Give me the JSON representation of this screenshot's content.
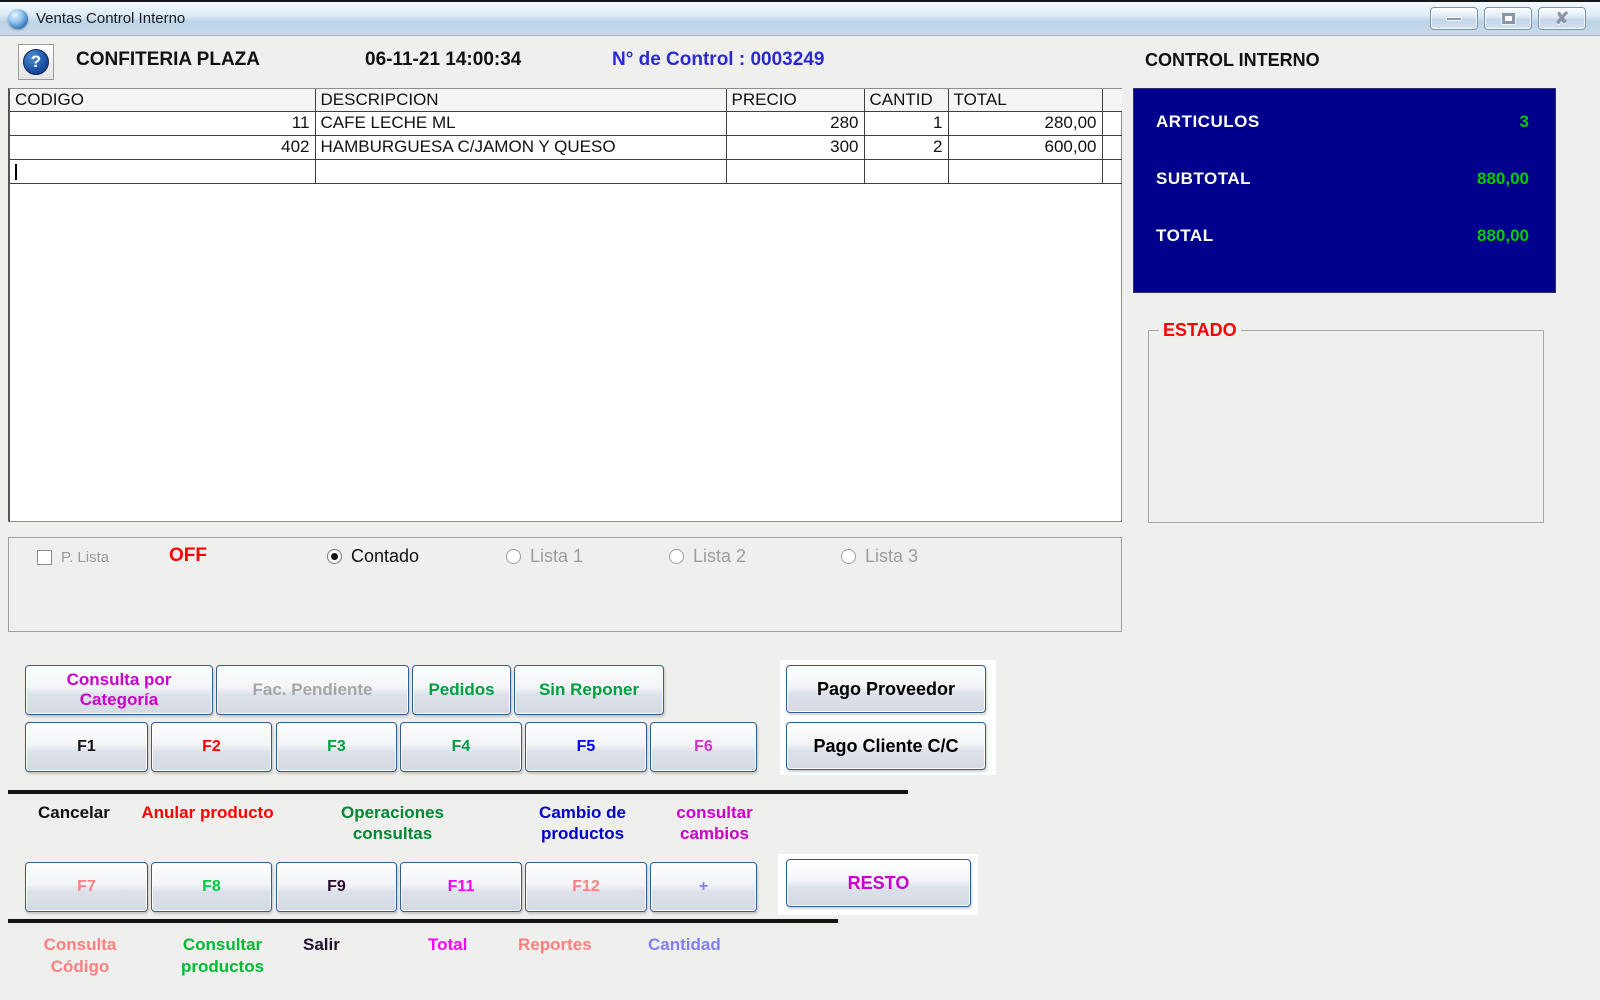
{
  "window": {
    "title": "Ventas Control Interno"
  },
  "header": {
    "store": "CONFITERIA PLAZA",
    "datetime": "06-11-21  14:00:34",
    "control_label": "N° de Control :  ",
    "control_number": "0003249",
    "right_title": "CONTROL INTERNO"
  },
  "table": {
    "columns": [
      "CODIGO",
      "DESCRIPCION",
      "PRECIO",
      "CANTID",
      "TOTAL"
    ],
    "rows": [
      {
        "codigo": "11",
        "descripcion": "CAFE LECHE ML",
        "precio": "280",
        "cantid": "1",
        "total": "280,00"
      },
      {
        "codigo": "402",
        "descripcion": "HAMBURGUESA C/JAMON Y QUESO",
        "precio": "300",
        "cantid": "2",
        "total": "600,00"
      }
    ]
  },
  "summary": {
    "articulos_label": "ARTICULOS",
    "articulos_value": "3",
    "subtotal_label": "SUBTOTAL",
    "subtotal_value": "880,00",
    "total_label": "TOTAL",
    "total_value": "880,00"
  },
  "estado_label": "ESTADO",
  "options": {
    "plista_label": "P. Lista",
    "off_label": "OFF",
    "radios": [
      {
        "label": "Contado",
        "selected": true,
        "enabled": true
      },
      {
        "label": "Lista 1",
        "selected": false,
        "enabled": false
      },
      {
        "label": "Lista 2",
        "selected": false,
        "enabled": false
      },
      {
        "label": "Lista 3",
        "selected": false,
        "enabled": false
      }
    ]
  },
  "actions_row1": [
    {
      "label": "Consulta por Categoría",
      "color": "#cc00cc"
    },
    {
      "label": "Fac. Pendiente",
      "color": "#a6a6a6"
    },
    {
      "label": "Pedidos",
      "color": "#00a040"
    },
    {
      "label": "Sin Reponer",
      "color": "#00a040"
    }
  ],
  "pago_proveedor_label": "Pago Proveedor",
  "fkeys_row1": [
    {
      "label": "F1",
      "color": "#111111"
    },
    {
      "label": "F2",
      "color": "#ff0000"
    },
    {
      "label": "F3",
      "color": "#00a040"
    },
    {
      "label": "F4",
      "color": "#00a040"
    },
    {
      "label": "F5",
      "color": "#0000ff"
    },
    {
      "label": "F6",
      "color": "#cc33cc"
    }
  ],
  "pago_cliente_label": "Pago Cliente C/C",
  "action_labels": [
    {
      "label": "Cancelar",
      "color": "#111111"
    },
    {
      "label": "Anular producto",
      "color": "#ff0000"
    },
    {
      "label": "Operaciones consultas",
      "color": "#008833"
    },
    {
      "label": "Cambio de productos",
      "color": "#0000cc"
    },
    {
      "label": "consultar cambios",
      "color": "#cc00cc"
    }
  ],
  "fkeys_row2": [
    {
      "label": "F7",
      "color": "#ff8080"
    },
    {
      "label": "F8",
      "color": "#00cc44"
    },
    {
      "label": "F9",
      "color": "#2b0a2b"
    },
    {
      "label": "F11",
      "color": "#ff00ff"
    },
    {
      "label": "F12",
      "color": "#ff8080"
    },
    {
      "label": "+",
      "color": "#8080f0"
    }
  ],
  "resto_label": "RESTO",
  "bottom_labels": [
    {
      "label": "Consulta Código",
      "color": "#ff7f7f"
    },
    {
      "label": "Consultar productos",
      "color": "#00bb33"
    },
    {
      "label": "Salir",
      "color": "#25102f"
    },
    {
      "label": "Total",
      "color": "#ff00ff"
    },
    {
      "label": "Reportes",
      "color": "#ff7f7f"
    },
    {
      "label": "Cantidad",
      "color": "#8080f0"
    }
  ],
  "colors": {
    "summary_bg": "#00008c",
    "value_green": "#00cc00",
    "estado_red": "#ff0000",
    "off_red": "#ff0000",
    "control_blue": "#2a2ad0"
  }
}
